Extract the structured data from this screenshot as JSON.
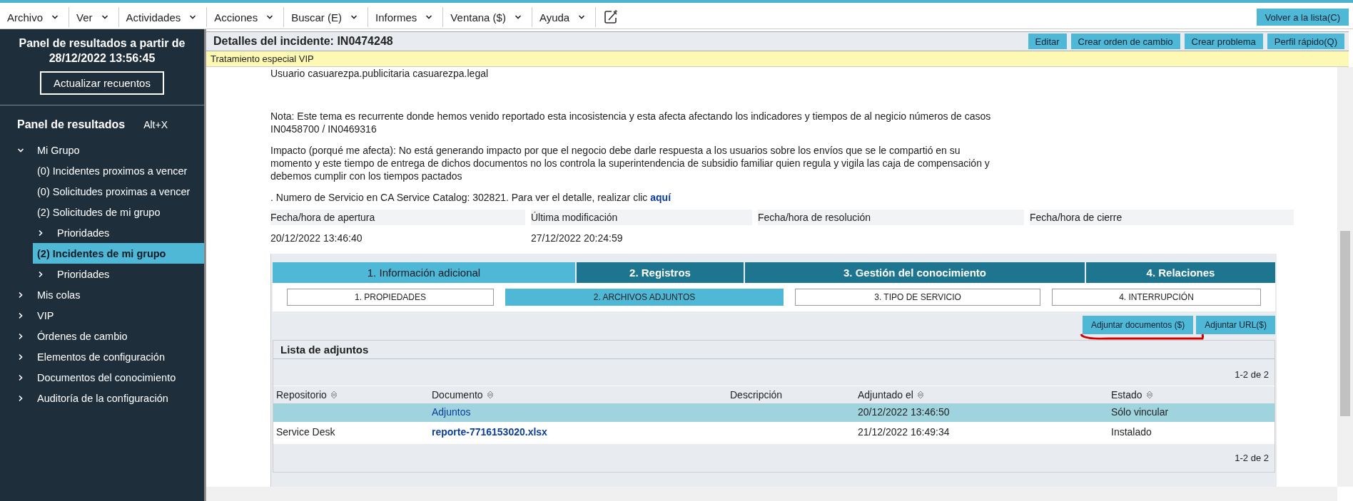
{
  "menu_bar": {
    "items": [
      {
        "label": "Archivo"
      },
      {
        "label": "Ver"
      },
      {
        "label": "Actividades"
      },
      {
        "label": "Acciones"
      },
      {
        "label": "Buscar (E)"
      },
      {
        "label": "Informes"
      },
      {
        "label": "Ventana ($)"
      },
      {
        "label": "Ayuda"
      }
    ],
    "back_button": "Volver a la lista(C)"
  },
  "sidebar": {
    "heading": "Panel de resultados a partir de 28/12/2022 13:56:45",
    "refresh_button": "Actualizar recuentos",
    "panel_title": "Panel de resultados",
    "shortcut": "Alt+X",
    "tree": [
      {
        "label": "Mi Grupo",
        "kind": "folder",
        "expanded": true,
        "selected": false,
        "children": [
          {
            "label": "(0) Incidentes proximos a vencer",
            "kind": "leaf",
            "selected": false
          },
          {
            "label": "(0) Solicitudes proximas a vencer",
            "kind": "leaf",
            "selected": false
          },
          {
            "label": "(2) Solicitudes de mi grupo",
            "kind": "leaf",
            "selected": false
          },
          {
            "label": "Prioridades",
            "kind": "folder",
            "expanded": false,
            "selected": false
          },
          {
            "label": "(2) Incidentes de mi grupo",
            "kind": "leaf",
            "selected": true
          },
          {
            "label": "Prioridades",
            "kind": "folder",
            "expanded": false,
            "selected": false
          }
        ]
      },
      {
        "label": "Mis colas",
        "kind": "folder",
        "expanded": false,
        "selected": false
      },
      {
        "label": "VIP",
        "kind": "folder",
        "expanded": false,
        "selected": false
      },
      {
        "label": "Órdenes de cambio",
        "kind": "folder",
        "expanded": false,
        "selected": false
      },
      {
        "label": "Elementos de configuración",
        "kind": "folder",
        "expanded": false,
        "selected": false
      },
      {
        "label": "Documentos del conocimiento",
        "kind": "folder",
        "expanded": false,
        "selected": false
      },
      {
        "label": "Auditoría de la configuración",
        "kind": "folder",
        "expanded": false,
        "selected": false
      }
    ]
  },
  "detail": {
    "title": "Detalles del incidente: IN0474248",
    "actions": [
      "Editar",
      "Crear orden de cambio",
      "Crear problema",
      "Perfil rápido(Q)"
    ],
    "banner": "Tratamiento especial VIP",
    "description": [
      "Usuario casuarezpa.publicitaria casuarezpa.legal",
      "Nota: Este tema es recurrente donde hemos venido reportado esta incosistencia y esta afecta afectando los indicadores y tiempos de al negicio números de casos IN0458700 / IN0469316",
      "Impacto (porqué me afecta): No está generando impacto por que el negocio debe darle respuesta a los usuarios sobre los envíos que se le compartió en su momento y este tiempo de entrega de dichos documentos no los controla la superintendencia de subsidio familiar quien regula y vigila las caja de compensación y debemos cumplir con los tiempos pactados"
    ],
    "catalog_note": {
      "text": ". Numero de Servicio en CA Service Catalog: 302821. Para ver el detalle, realizar clic ",
      "link": "aquí"
    },
    "dates": [
      {
        "label": "Fecha/hora de apertura",
        "value": "20/12/2022 13:46:40"
      },
      {
        "label": "Última modificación",
        "value": "27/12/2022 20:24:59"
      },
      {
        "label": "Fecha/hora de resolución"
      },
      {
        "label": "Fecha/hora de cierre"
      }
    ],
    "tabs": [
      {
        "label": "1. Información adicional",
        "selected": true
      },
      {
        "label": "2. Registros",
        "selected": false
      },
      {
        "label": "3. Gestión del conocimiento",
        "selected": false
      },
      {
        "label": "4. Relaciones",
        "selected": false
      }
    ],
    "subtabs": [
      {
        "label": "1. PROPIEDADES",
        "selected": false
      },
      {
        "label": "2. ARCHIVOS ADJUNTOS",
        "selected": true
      },
      {
        "label": "3. TIPO DE SERVICIO",
        "selected": false
      },
      {
        "label": "4. INTERRUPCIÓN",
        "selected": false
      }
    ],
    "attach_buttons": [
      "Adjuntar documentos ($)",
      "Adjuntar URL($)"
    ],
    "attachments": {
      "title": "Lista de adjuntos",
      "pager_top": "1-2 de 2",
      "columns": [
        {
          "label": "Repositorio",
          "sortable": true
        },
        {
          "label": "Documento",
          "sortable": true
        },
        {
          "label": "Descripción",
          "sortable": false
        },
        {
          "label": "Adjuntado el",
          "sortable": true
        },
        {
          "label": "Estado",
          "sortable": true
        }
      ],
      "rows": [
        {
          "selected": true,
          "document": "Adjuntos",
          "attached": "20/12/2022 13:46:50",
          "status": "Sólo vincular"
        },
        {
          "selected": false,
          "repository": "Service Desk",
          "document": "reporte-7716153020.xlsx",
          "attached": "21/12/2022 16:49:34",
          "status": "Instalado"
        }
      ],
      "pager_bottom": "1-2 de 2"
    }
  }
}
